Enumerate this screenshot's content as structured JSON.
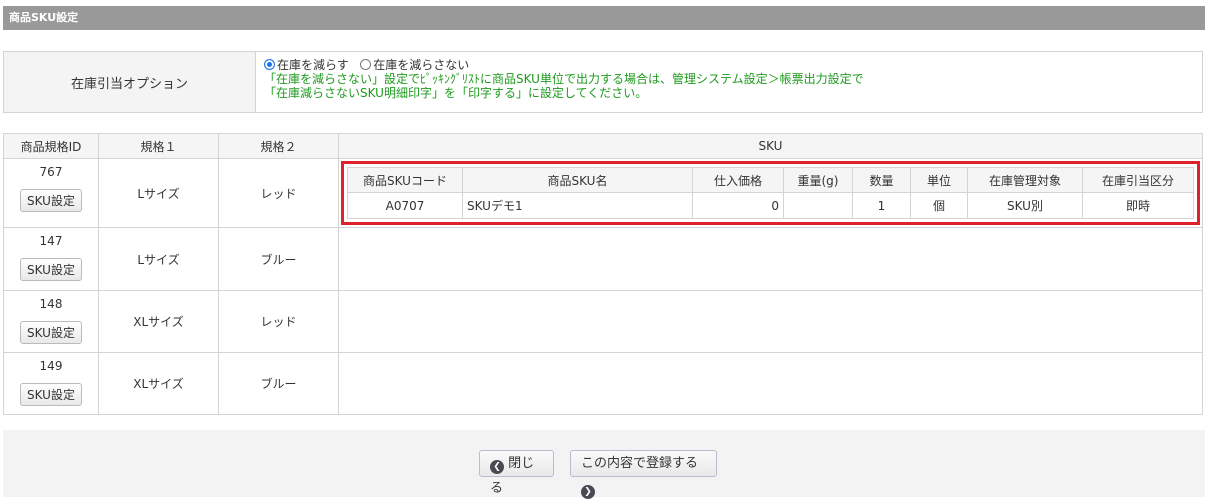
{
  "header": {
    "title": "商品SKU設定"
  },
  "option": {
    "label": "在庫引当オプション",
    "radio1": "在庫を減らす",
    "radio2": "在庫を減らさない",
    "selected": "在庫を減らす",
    "note1": "「在庫を減らさない」設定でﾋﾟｯｷﾝｸﾞﾘｽﾄに商品SKU単位で出力する場合は、管理システム設定＞帳票出力設定で",
    "note2": "「在庫減らさないSKU明細印字」を「印字する」に設定してください。"
  },
  "table": {
    "headers": [
      "商品規格ID",
      "規格１",
      "規格２",
      "SKU"
    ],
    "sku_button": "SKU設定",
    "rows": [
      {
        "id": "767",
        "spec1": "Lサイズ",
        "spec2": "レッド"
      },
      {
        "id": "147",
        "spec1": "Lサイズ",
        "spec2": "ブルー"
      },
      {
        "id": "148",
        "spec1": "XLサイズ",
        "spec2": "レッド"
      },
      {
        "id": "149",
        "spec1": "XLサイズ",
        "spec2": "ブルー"
      }
    ],
    "sku_headers": [
      "商品SKUコード",
      "商品SKU名",
      "仕入価格",
      "重量(g)",
      "数量",
      "単位",
      "在庫管理対象",
      "在庫引当区分"
    ],
    "sku_row": [
      "A0707",
      "SKUデモ1",
      "0",
      "",
      "1",
      "個",
      "SKU別",
      "即時"
    ]
  },
  "footer": {
    "close": "閉じる",
    "register": "この内容で登録する"
  }
}
